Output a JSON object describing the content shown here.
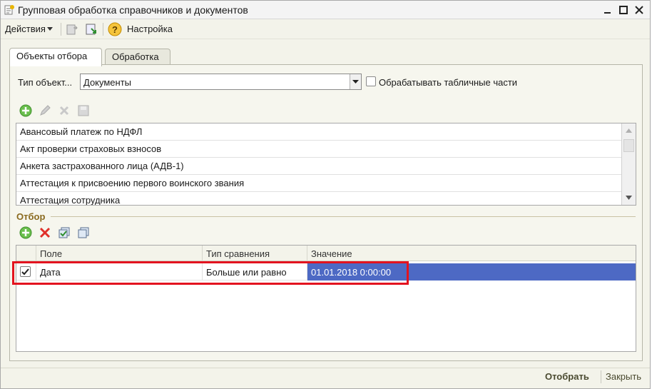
{
  "window": {
    "title": "Групповая обработка справочников и документов"
  },
  "toolbar": {
    "actions_label": "Действия",
    "settings_label": "Настройка"
  },
  "tabs": [
    {
      "label": "Объекты отбора",
      "active": true
    },
    {
      "label": "Обработка",
      "active": false
    }
  ],
  "object_type": {
    "label": "Тип объект...",
    "value": "Документы",
    "process_tabular_label": "Обрабатывать табличные части",
    "process_tabular_checked": false
  },
  "objects": [
    "Авансовый платеж по НДФЛ",
    "Акт проверки страховых взносов",
    "Анкета застрахованного лица (АДВ-1)",
    "Аттестация к присвоению первого воинского звания",
    "Аттестация сотрудника"
  ],
  "filter": {
    "title": "Отбор",
    "columns": [
      "Поле",
      "Тип сравнения",
      "Значение"
    ],
    "rows": [
      {
        "checked": true,
        "field": "Дата",
        "comparison": "Больше или равно",
        "value": "01.01.2018 0:00:00"
      }
    ]
  },
  "footer": {
    "select_label": "Отобрать",
    "close_label": "Закрыть"
  },
  "colors": {
    "selection": "#4d69c4",
    "highlight": "#e3131f",
    "section_title": "#8a6a1f"
  }
}
